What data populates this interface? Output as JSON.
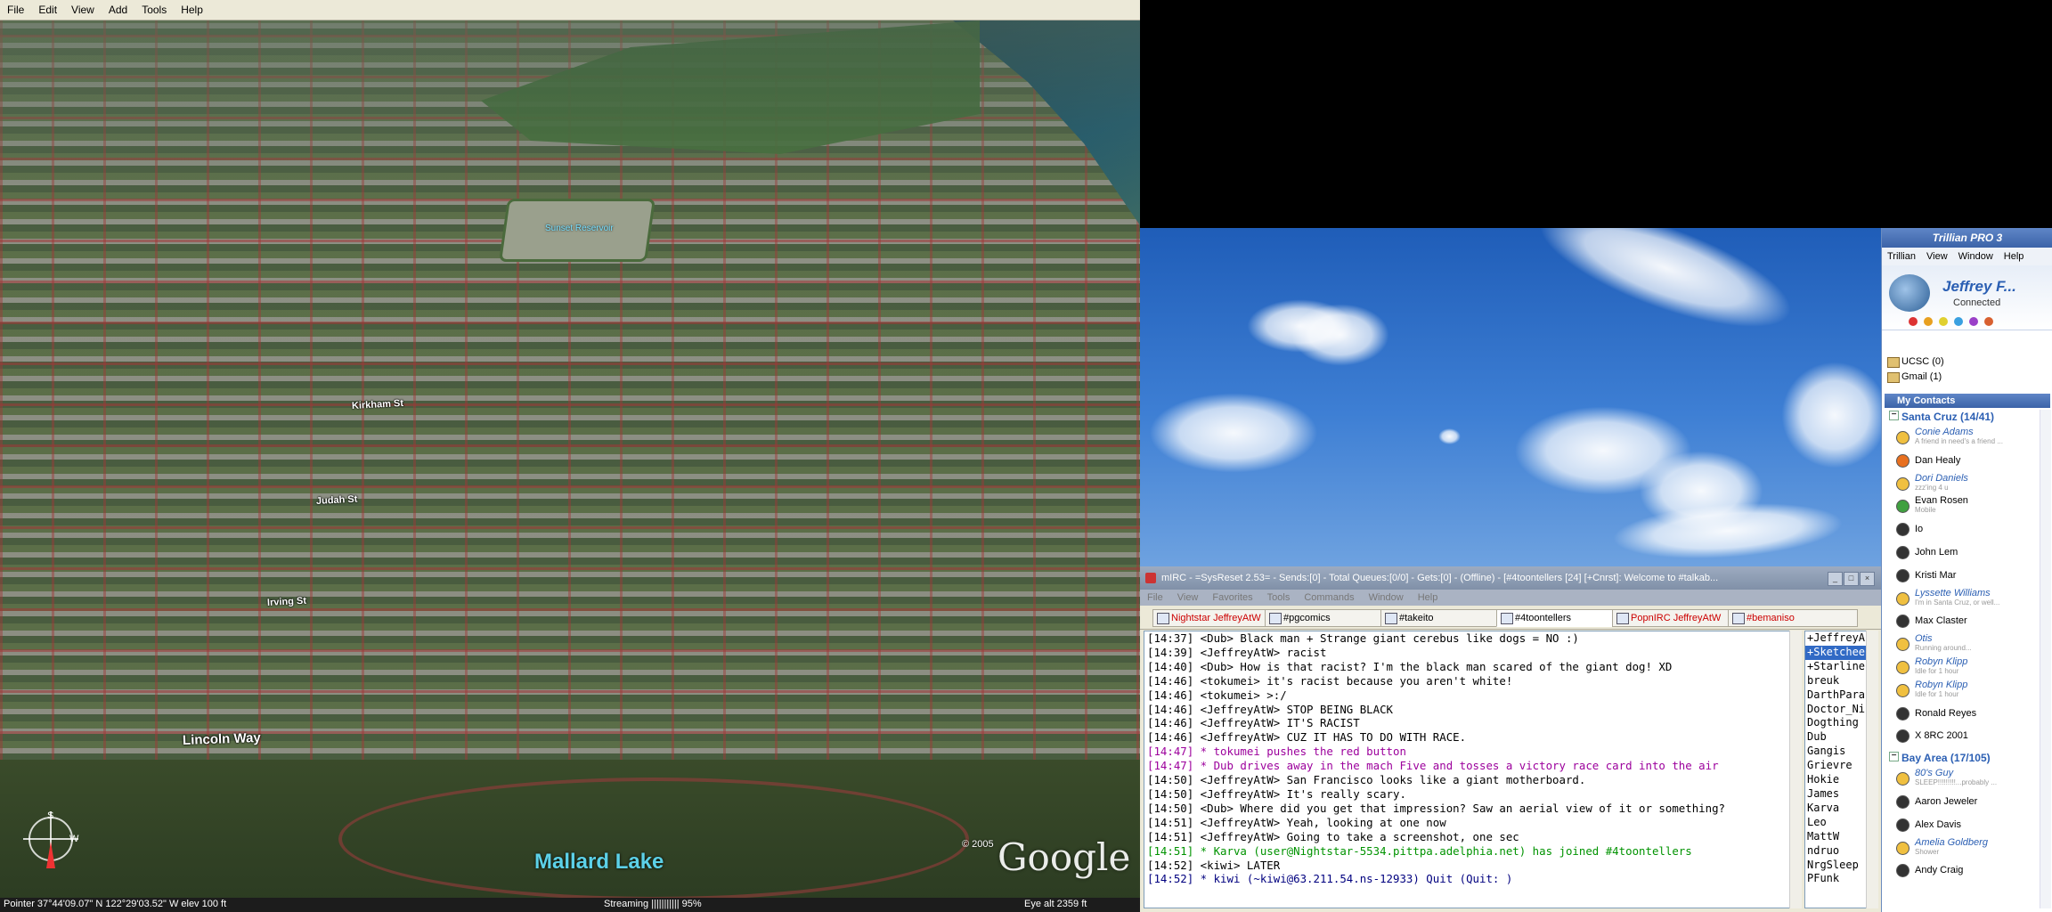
{
  "google_earth": {
    "menu": [
      "File",
      "Edit",
      "View",
      "Add",
      "Tools",
      "Help"
    ],
    "labels": {
      "reservoir": "Sunset Reservoir",
      "kirkham": "Kirkham St",
      "judah": "Judah St",
      "irving": "Irving St",
      "lincoln": "Lincoln Way",
      "mallard": "Mallard Lake"
    },
    "copyright": "© 2005",
    "logo": "Google",
    "status": {
      "pointer": "Pointer  37°44'09.07\"  N  122°29'03.52\"  W   elev   100 ft",
      "streaming": "Streaming |||||||||||        95%",
      "eye_alt": "Eye  alt    2359 ft"
    }
  },
  "mirc": {
    "title": "mIRC - =SysReset 2.53= - Sends:[0] - Total Queues:[0/0] - Gets:[0] - (Offline) - [#4toontellers [24] [+Cnrst]: Welcome to #talkab...",
    "menu": [
      "File",
      "View",
      "Favorites",
      "Tools",
      "Commands",
      "Window",
      "Help"
    ],
    "tabs": [
      "Nightstar JeffreyAtW",
      "#pgcomics",
      "#takeito",
      "#4toontellers",
      "PopnIRC JeffreyAtW",
      "#bemaniso"
    ],
    "active_tab": "#4toontellers",
    "lines": [
      {
        "type": "msg",
        "text": "[14:37] <Dub> Black man + Strange giant cerebus like dogs = NO :)"
      },
      {
        "type": "msg",
        "text": "[14:39] <JeffreyAtW> racist"
      },
      {
        "type": "msg",
        "text": "[14:40] <Dub> How is that racist? I'm the black man scared of the giant dog! XD"
      },
      {
        "type": "msg",
        "text": "[14:46] <tokumei> it's racist because you aren't white!"
      },
      {
        "type": "msg",
        "text": "[14:46] <tokumei> >:/"
      },
      {
        "type": "msg",
        "text": "[14:46] <JeffreyAtW> STOP BEING BLACK"
      },
      {
        "type": "msg",
        "text": "[14:46] <JeffreyAtW> IT'S RACIST"
      },
      {
        "type": "msg",
        "text": "[14:46] <JeffreyAtW> CUZ IT HAS TO DO WITH RACE."
      },
      {
        "type": "action",
        "text": "[14:47] * tokumei pushes the red button"
      },
      {
        "type": "action",
        "text": "[14:47] * Dub drives away in the mach Five and tosses a victory race card into the air"
      },
      {
        "type": "msg",
        "text": "[14:50] <JeffreyAtW> San Francisco looks like a giant motherboard."
      },
      {
        "type": "msg",
        "text": "[14:50] <JeffreyAtW> It's really scary."
      },
      {
        "type": "msg",
        "text": "[14:50] <Dub> Where did you get that impression? Saw an aerial view of it or something?"
      },
      {
        "type": "msg",
        "text": "[14:51] <JeffreyAtW> Yeah, looking at one now"
      },
      {
        "type": "msg",
        "text": "[14:51] <JeffreyAtW> Going to take a screenshot, one sec"
      },
      {
        "type": "join",
        "text": "[14:51] * Karva (user@Nightstar-5534.pittpa.adelphia.net) has joined #4toontellers"
      },
      {
        "type": "msg",
        "text": "[14:52] <kiwi> LATER"
      },
      {
        "type": "quit",
        "text": "[14:52] * kiwi (~kiwi@63.211.54.ns-12933) Quit (Quit: )"
      }
    ],
    "nicks": [
      "+JeffreyA",
      "+Sketchee",
      "+Starline",
      "breuk",
      "DarthParac",
      "Doctor_Nic",
      "Dogthing",
      "Dub",
      "Gangis",
      "Grievre",
      "Hokie",
      "James",
      "Karva",
      "Leo",
      "MattW",
      "ndruo",
      "NrgSleep",
      "PFunk"
    ],
    "selected_nick": "+Sketchee"
  },
  "trillian": {
    "title": "Trillian PRO 3",
    "menu": [
      "Trillian",
      "View",
      "Window",
      "Help"
    ],
    "user_name": "Jeffrey F...",
    "user_status": "Connected",
    "status_colors": [
      "#d33",
      "#e8a020",
      "#e0d030",
      "#3aa0e0",
      "#9a40c8",
      "#d86030"
    ],
    "accounts": [
      "UCSC (0)",
      "Gmail (1)"
    ],
    "contacts_header": "My Contacts",
    "groups": [
      {
        "name": "Santa Cruz (14/41)",
        "contacts": [
          {
            "name": "Conie Adams",
            "msg": "A friend in need's a friend ...",
            "away": true,
            "color": "#f0c040"
          },
          {
            "name": "Dan Healy",
            "msg": "",
            "away": false,
            "color": "#e87020"
          },
          {
            "name": "Dori Daniels",
            "msg": "zzz'ing 4 u",
            "away": true,
            "color": "#f0c040"
          },
          {
            "name": "Evan Rosen",
            "msg": "Mobile",
            "away": false,
            "color": "#40a040"
          },
          {
            "name": "Io",
            "msg": "",
            "away": false,
            "color": "#333"
          },
          {
            "name": "John Lem",
            "msg": "",
            "away": false,
            "color": "#333"
          },
          {
            "name": "Kristi Mar",
            "msg": "",
            "away": false,
            "color": "#333"
          },
          {
            "name": "Lyssette Williams",
            "msg": "I'm in Santa Cruz, or well...",
            "away": true,
            "color": "#f0c040"
          },
          {
            "name": "Max Claster",
            "msg": "",
            "away": false,
            "color": "#333"
          },
          {
            "name": "Otis",
            "msg": "Running around...",
            "away": true,
            "color": "#f0c040"
          },
          {
            "name": "Robyn Klipp",
            "msg": "Idle for 1 hour",
            "away": true,
            "color": "#f0c040"
          },
          {
            "name": "Robyn Klipp",
            "msg": "Idle for 1 hour",
            "away": true,
            "color": "#f0c040"
          },
          {
            "name": "Ronald Reyes",
            "msg": "",
            "away": false,
            "color": "#333"
          },
          {
            "name": "X 8RC 2001",
            "msg": "",
            "away": false,
            "color": "#333"
          }
        ]
      },
      {
        "name": "Bay Area (17/105)",
        "contacts": [
          {
            "name": "80's Guy",
            "msg": "SLEEP!!!!!!!!!...probably ...",
            "away": true,
            "color": "#f0c040"
          },
          {
            "name": "Aaron Jeweler",
            "msg": "",
            "away": false,
            "color": "#333"
          },
          {
            "name": "Alex Davis",
            "msg": "",
            "away": false,
            "color": "#333"
          },
          {
            "name": "Amelia Goldberg",
            "msg": "Shower",
            "away": true,
            "color": "#f0c040"
          },
          {
            "name": "Andy Craig",
            "msg": "",
            "away": false,
            "color": "#333"
          }
        ]
      }
    ]
  }
}
